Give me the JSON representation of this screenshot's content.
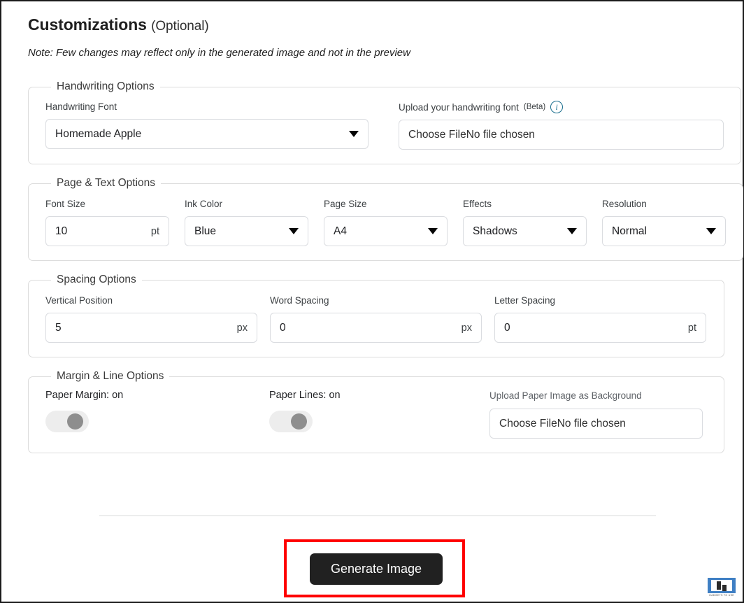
{
  "header": {
    "title": "Customizations",
    "optional": "(Optional)",
    "note": "Note: Few changes may reflect only in the generated image and not in the preview"
  },
  "groups": {
    "handwriting": {
      "legend": "Handwriting Options",
      "font_label": "Handwriting Font",
      "font_value": "Homemade Apple",
      "upload_label": "Upload your handwriting font",
      "upload_beta": "(Beta)",
      "upload_info_icon": "info-icon",
      "upload_value": "Choose FileNo file chosen"
    },
    "page_text": {
      "legend": "Page & Text Options",
      "fields": [
        {
          "label": "Font Size",
          "value": "10",
          "unit": "pt"
        },
        {
          "label": "Ink Color",
          "value": "Blue"
        },
        {
          "label": "Page Size",
          "value": "A4"
        },
        {
          "label": "Effects",
          "value": "Shadows"
        },
        {
          "label": "Resolution",
          "value": "Normal"
        }
      ]
    },
    "spacing": {
      "legend": "Spacing Options",
      "fields": [
        {
          "label": "Vertical Position",
          "value": "5",
          "unit": "px"
        },
        {
          "label": "Word Spacing",
          "value": "0",
          "unit": "px"
        },
        {
          "label": "Letter Spacing",
          "value": "0",
          "unit": "pt"
        }
      ]
    },
    "margin_line": {
      "legend": "Margin & Line Options",
      "paper_margin_label": "Paper Margin: on",
      "paper_lines_label": "Paper Lines: on",
      "upload_label": "Upload Paper Image as Background",
      "upload_value": "Choose FileNo file chosen"
    }
  },
  "footer": {
    "generate_label": "Generate Image",
    "highlight_color": "#ff0000",
    "button_color": "#212121"
  },
  "watermark": {
    "text": "GADGETS TO USE"
  }
}
